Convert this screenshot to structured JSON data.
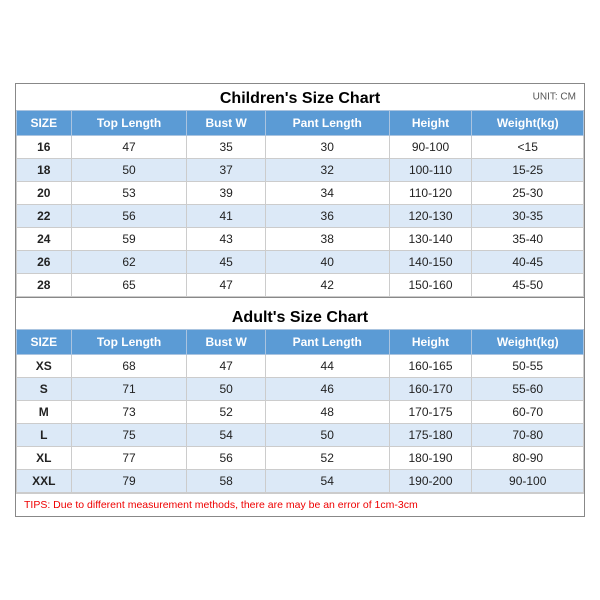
{
  "children_title": "Children's Size Chart",
  "adult_title": "Adult's Size Chart",
  "unit": "UNIT: CM",
  "headers": [
    "SIZE",
    "Top Length",
    "Bust W",
    "Pant Length",
    "Height",
    "Weight(kg)"
  ],
  "children_rows": [
    [
      "16",
      "47",
      "35",
      "30",
      "90-100",
      "<15"
    ],
    [
      "18",
      "50",
      "37",
      "32",
      "100-110",
      "15-25"
    ],
    [
      "20",
      "53",
      "39",
      "34",
      "110-120",
      "25-30"
    ],
    [
      "22",
      "56",
      "41",
      "36",
      "120-130",
      "30-35"
    ],
    [
      "24",
      "59",
      "43",
      "38",
      "130-140",
      "35-40"
    ],
    [
      "26",
      "62",
      "45",
      "40",
      "140-150",
      "40-45"
    ],
    [
      "28",
      "65",
      "47",
      "42",
      "150-160",
      "45-50"
    ]
  ],
  "adult_rows": [
    [
      "XS",
      "68",
      "47",
      "44",
      "160-165",
      "50-55"
    ],
    [
      "S",
      "71",
      "50",
      "46",
      "160-170",
      "55-60"
    ],
    [
      "M",
      "73",
      "52",
      "48",
      "170-175",
      "60-70"
    ],
    [
      "L",
      "75",
      "54",
      "50",
      "175-180",
      "70-80"
    ],
    [
      "XL",
      "77",
      "56",
      "52",
      "180-190",
      "80-90"
    ],
    [
      "XXL",
      "79",
      "58",
      "54",
      "190-200",
      "90-100"
    ]
  ],
  "tips": "TIPS: Due to different measurement methods, there are may be an error of 1cm-3cm"
}
